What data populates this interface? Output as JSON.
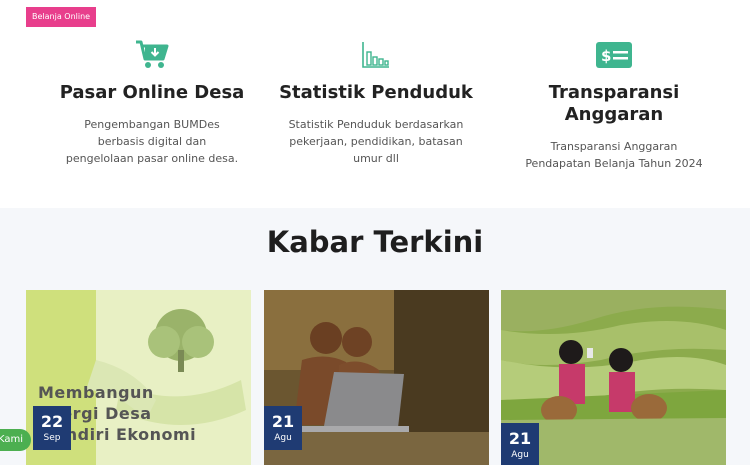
{
  "badge": "Belanja Online",
  "features": [
    {
      "icon": "shopping-cart-icon",
      "title": "Pasar Online Desa",
      "desc": "Pengembangan BUMDes berbasis digital dan pengelolaan pasar online desa."
    },
    {
      "icon": "bar-chart-icon",
      "title": "Statistik Penduduk",
      "desc": "Statistik Penduduk berdasarkan pekerjaan, pendidikan, batasan umur dll"
    },
    {
      "icon": "money-bill-icon",
      "title": "Transparansi Anggaran",
      "desc": "Transparansi Anggaran Pendapatan Belanja Tahun 2024"
    }
  ],
  "news": {
    "title": "Kabar Terkini",
    "cards": [
      {
        "image_text": "Membangun Energi Desa Mandiri Ekonomi",
        "day": "22",
        "month": "Sep"
      },
      {
        "day": "21",
        "month": "Agu"
      },
      {
        "day": "21",
        "month": "Agu"
      }
    ]
  },
  "contact_label": "Kami",
  "colors": {
    "accent_green": "#3fb58f",
    "badge_pink": "#e83e8c",
    "date_navy": "#1f3b73"
  }
}
